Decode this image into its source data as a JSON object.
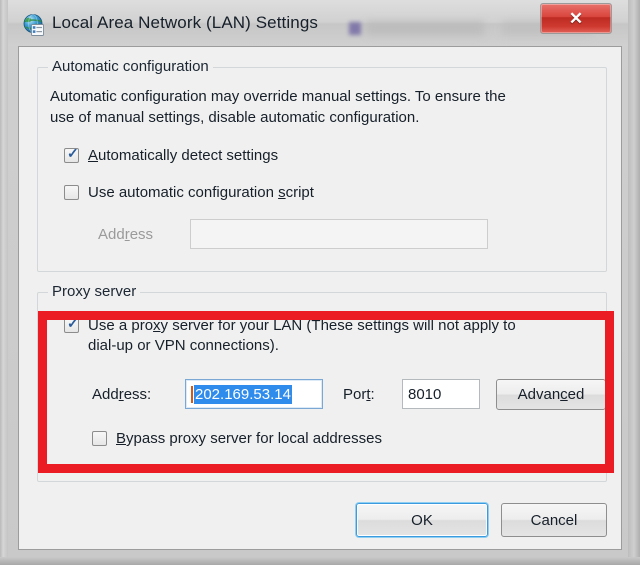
{
  "window": {
    "title": "Local Area Network (LAN) Settings",
    "app_icon": "network-globe-icon",
    "close_label": "✕",
    "close_icon": "close-icon"
  },
  "automatic_configuration": {
    "legend": "Automatic configuration",
    "description_line1": "Automatic configuration may override manual settings.  To ensure the",
    "description_line2": "use of manual settings, disable automatic configuration.",
    "auto_detect": {
      "label_pre": "",
      "accel": "A",
      "label_post": "utomatically detect settings",
      "checked": true,
      "check_glyph": "✓"
    },
    "auto_script": {
      "label_pre": "Use automatic configuration ",
      "accel": "s",
      "label_post": "cript",
      "checked": false
    },
    "address": {
      "label_pre": "Add",
      "accel": "r",
      "label_post": "ess",
      "value": "",
      "placeholder": "",
      "disabled": true
    }
  },
  "proxy_server": {
    "legend": "Proxy server",
    "use_proxy": {
      "line1_pre": "Use a pro",
      "line1_accel": "x",
      "line1_post": "y server for your LAN (These settings will not apply to",
      "line2": "dial-up or VPN connections).",
      "checked": true,
      "check_glyph": "✓"
    },
    "address": {
      "label_pre": "Add",
      "accel": "r",
      "label_post": "ess:",
      "value": "202.169.53.14",
      "selected": true,
      "focused": true
    },
    "port": {
      "label_pre": "Por",
      "accel": "t",
      "label_post": ":",
      "value": "8010"
    },
    "advanced_button": {
      "label_pre": "Advan",
      "accel": "c",
      "label_post": "ed"
    },
    "bypass": {
      "accel": "B",
      "label_post": "ypass proxy server for local addresses",
      "checked": false
    }
  },
  "footer": {
    "ok_label": "OK",
    "cancel_label": "Cancel"
  },
  "annotation": {
    "color": "#ec1c24",
    "shape": "rectangle-highlight"
  }
}
